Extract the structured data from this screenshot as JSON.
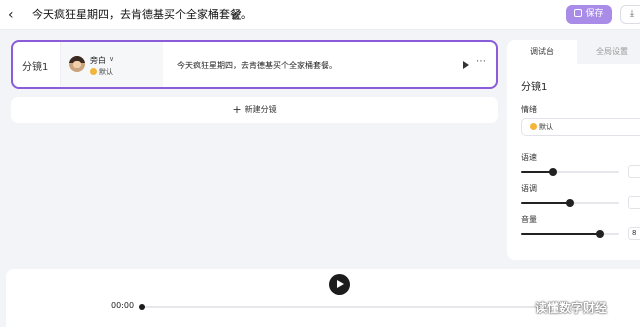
{
  "header": {
    "back_icon": "chevron-left-icon",
    "title": "今天疯狂星期四，去肯德基买个全家桶套餐。",
    "edit_icon": "pencil-icon",
    "save_label": "保存",
    "save_icon": "save-icon",
    "download_icon": "download-icon"
  },
  "shot": {
    "label": "分镜1",
    "voice_name": "旁白",
    "voice_mood": "默认",
    "text": "今天疯狂星期四，去肯德基买个全家桶套餐。",
    "play_icon": "play-icon",
    "more_icon": "more-horizontal-icon"
  },
  "new_shot_label": "新建分镜",
  "panel": {
    "tabs": [
      "调试台",
      "全局设置"
    ],
    "heading": "分镜1",
    "mood_label": "情绪",
    "mood_value": "默认",
    "speed_label": "语速",
    "pitch_label": "语调",
    "volume_label": "音量",
    "speed_level": 0.33,
    "pitch_level": 0.5,
    "volume_level": 0.81,
    "volume_input_partial": "8"
  },
  "player": {
    "time": "00:00",
    "progress": 0,
    "play_icon": "play-circle-icon"
  },
  "watermark": "读懂数字财经",
  "colors": {
    "accent": "#8b5cd9",
    "save_button": "#a98be8",
    "dark": "#1c1c1c"
  }
}
